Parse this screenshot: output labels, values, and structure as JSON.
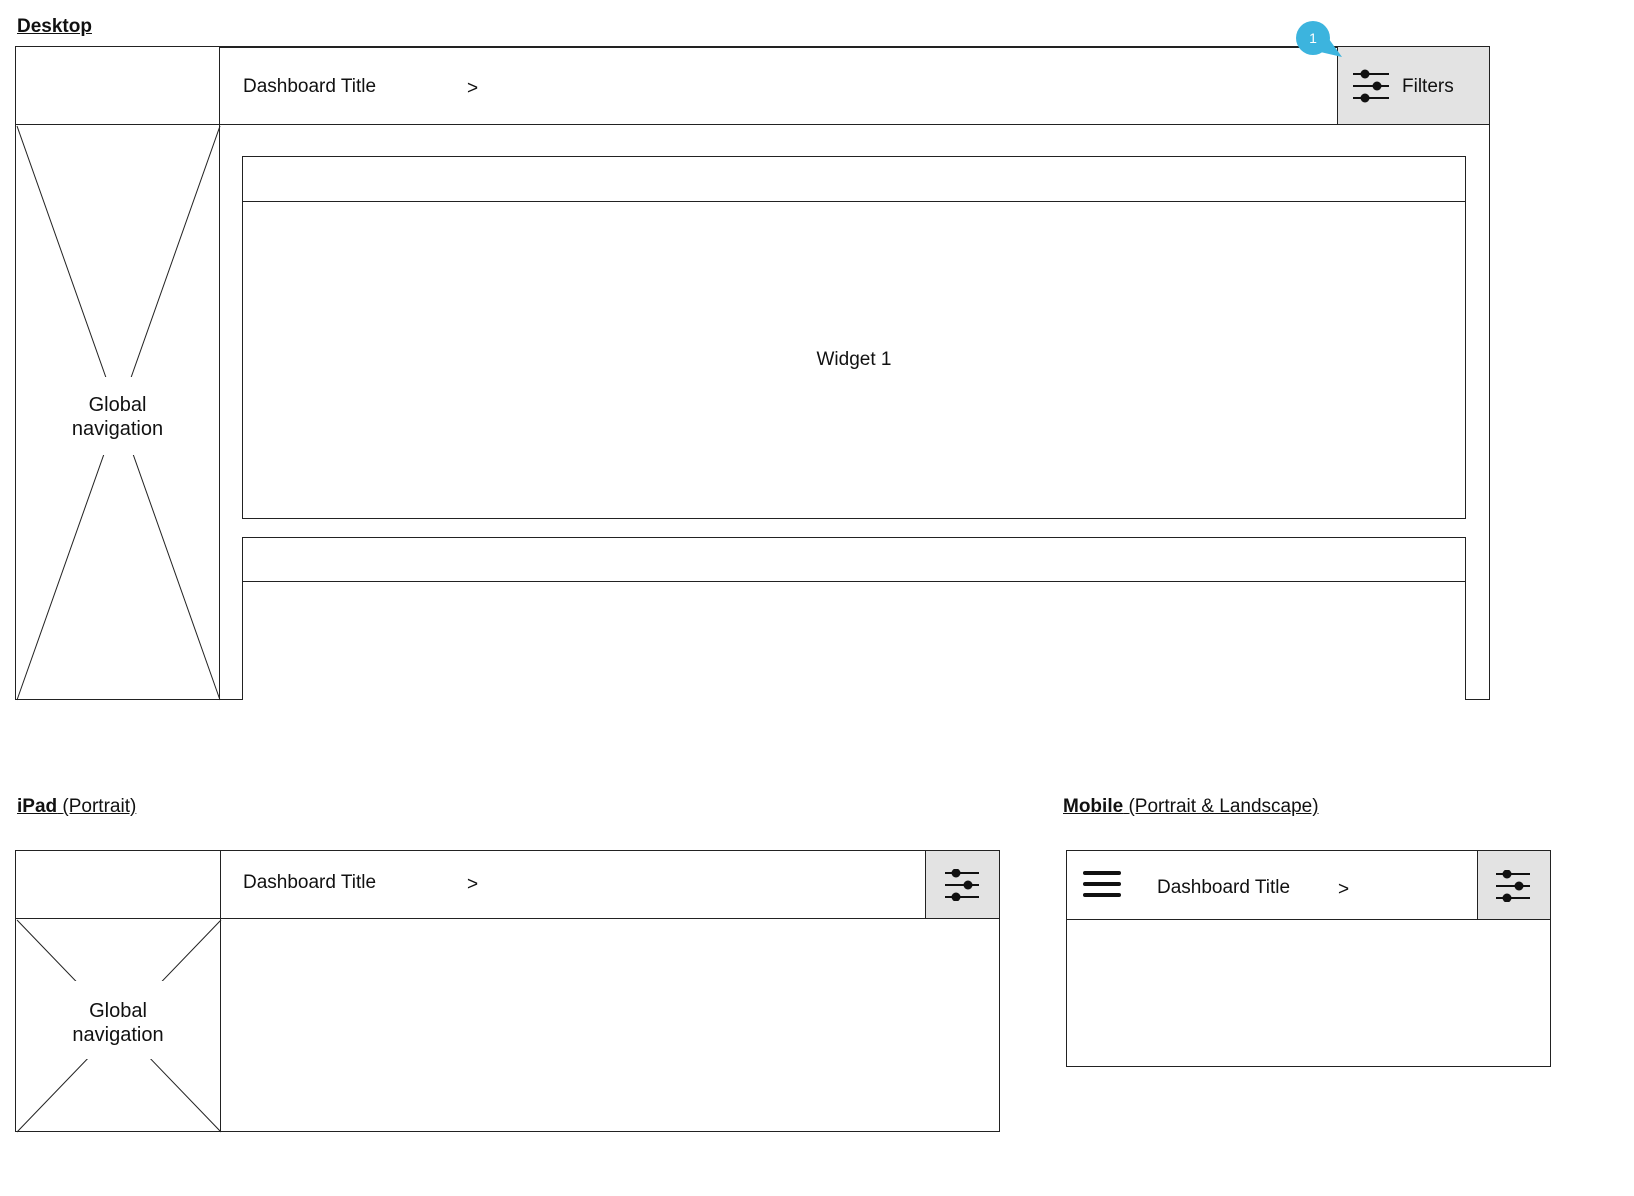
{
  "desktop": {
    "heading": "Desktop",
    "dashboard_title": "Dashboard Title",
    "breadcrumb_chevron": ">",
    "filters_label": "Filters",
    "badge_number": "1",
    "nav_placeholder_line1": "Global",
    "nav_placeholder_line2": "navigation",
    "widget1_label": "Widget 1"
  },
  "ipad": {
    "heading_bold": "iPad",
    "heading_rest": "(Portrait)",
    "dashboard_title": "Dashboard Title",
    "breadcrumb_chevron": ">",
    "nav_placeholder_line1": "Global",
    "nav_placeholder_line2": "navigation"
  },
  "mobile": {
    "heading_bold": "Mobile",
    "heading_rest": "(Portrait & Landscape)",
    "dashboard_title": "Dashboard Title",
    "breadcrumb_chevron": ">"
  },
  "icons": {
    "filter": "sliders-icon",
    "menu": "hamburger-menu-icon"
  },
  "colors": {
    "filter_button_bg": "#e3e3e3",
    "badge": "#3cb4de"
  }
}
